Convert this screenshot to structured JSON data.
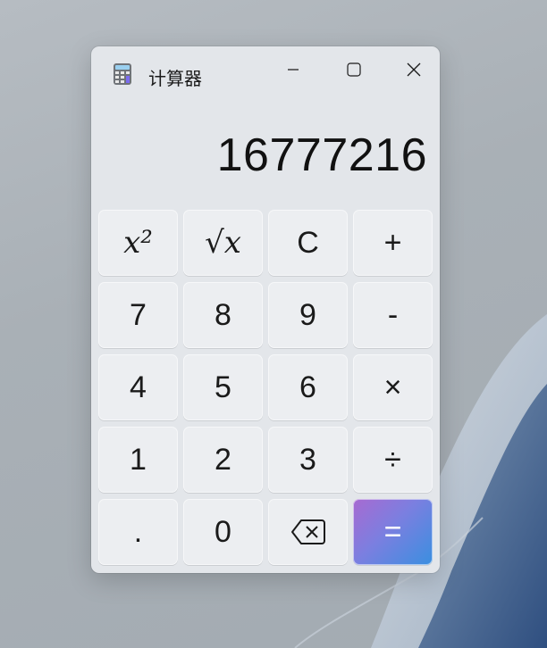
{
  "window": {
    "title": "计算器"
  },
  "display": {
    "value": "16777216"
  },
  "keys": {
    "square": {
      "label": "x²"
    },
    "sqrt": {
      "label": "√x"
    },
    "clear": {
      "label": "C"
    },
    "plus": {
      "label": "+"
    },
    "seven": {
      "label": "7"
    },
    "eight": {
      "label": "8"
    },
    "nine": {
      "label": "9"
    },
    "minus": {
      "label": "-"
    },
    "four": {
      "label": "4"
    },
    "five": {
      "label": "5"
    },
    "six": {
      "label": "6"
    },
    "multiply": {
      "label": "×"
    },
    "one": {
      "label": "1"
    },
    "two": {
      "label": "2"
    },
    "three": {
      "label": "3"
    },
    "divide": {
      "label": "÷"
    },
    "decimal": {
      "label": "."
    },
    "zero": {
      "label": "0"
    },
    "backspace": {
      "icon": "backspace-icon"
    },
    "equals": {
      "label": "="
    }
  },
  "icons": {
    "app": "calculator-icon",
    "minimize": "minimize-icon",
    "maximize": "maximize-icon",
    "close": "close-icon"
  },
  "colors": {
    "window_bg": "#e3e6ea",
    "key_bg": "#eceef1",
    "equals_gradient_start": "#a86ad1",
    "equals_gradient_end": "#3a8fe0"
  }
}
